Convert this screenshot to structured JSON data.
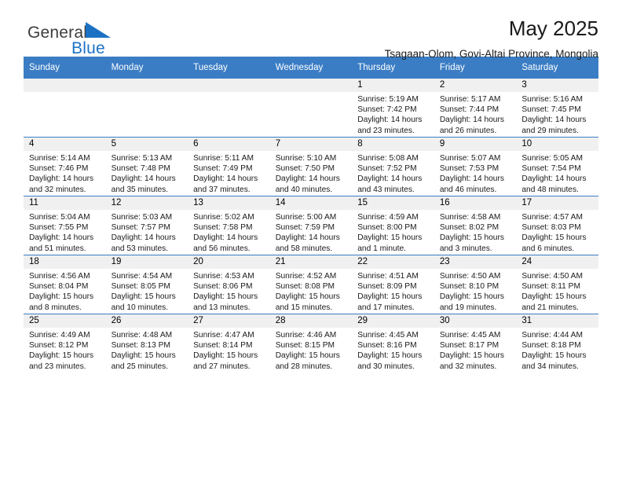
{
  "brand": {
    "name_part1": "General",
    "name_part2": "Blue",
    "triangle_color": "#1b72c4"
  },
  "header": {
    "title": "May 2025",
    "subtitle": "Tsagaan-Olom, Govi-Altai Province, Mongolia"
  },
  "theme": {
    "header_blue": "#3b7dc4",
    "date_band": "#f0f0f0",
    "text": "#1a1a1a"
  },
  "weekday_headers": [
    "Sunday",
    "Monday",
    "Tuesday",
    "Wednesday",
    "Thursday",
    "Friday",
    "Saturday"
  ],
  "weeks": [
    [
      {
        "day": "",
        "empty": true,
        "sunrise": "",
        "sunset": "",
        "daylight1": "",
        "daylight2": ""
      },
      {
        "day": "",
        "empty": true,
        "sunrise": "",
        "sunset": "",
        "daylight1": "",
        "daylight2": ""
      },
      {
        "day": "",
        "empty": true,
        "sunrise": "",
        "sunset": "",
        "daylight1": "",
        "daylight2": ""
      },
      {
        "day": "",
        "empty": true,
        "sunrise": "",
        "sunset": "",
        "daylight1": "",
        "daylight2": ""
      },
      {
        "day": "1",
        "sunrise": "Sunrise: 5:19 AM",
        "sunset": "Sunset: 7:42 PM",
        "daylight1": "Daylight: 14 hours",
        "daylight2": "and 23 minutes."
      },
      {
        "day": "2",
        "sunrise": "Sunrise: 5:17 AM",
        "sunset": "Sunset: 7:44 PM",
        "daylight1": "Daylight: 14 hours",
        "daylight2": "and 26 minutes."
      },
      {
        "day": "3",
        "sunrise": "Sunrise: 5:16 AM",
        "sunset": "Sunset: 7:45 PM",
        "daylight1": "Daylight: 14 hours",
        "daylight2": "and 29 minutes."
      }
    ],
    [
      {
        "day": "4",
        "sunrise": "Sunrise: 5:14 AM",
        "sunset": "Sunset: 7:46 PM",
        "daylight1": "Daylight: 14 hours",
        "daylight2": "and 32 minutes."
      },
      {
        "day": "5",
        "sunrise": "Sunrise: 5:13 AM",
        "sunset": "Sunset: 7:48 PM",
        "daylight1": "Daylight: 14 hours",
        "daylight2": "and 35 minutes."
      },
      {
        "day": "6",
        "sunrise": "Sunrise: 5:11 AM",
        "sunset": "Sunset: 7:49 PM",
        "daylight1": "Daylight: 14 hours",
        "daylight2": "and 37 minutes."
      },
      {
        "day": "7",
        "sunrise": "Sunrise: 5:10 AM",
        "sunset": "Sunset: 7:50 PM",
        "daylight1": "Daylight: 14 hours",
        "daylight2": "and 40 minutes."
      },
      {
        "day": "8",
        "sunrise": "Sunrise: 5:08 AM",
        "sunset": "Sunset: 7:52 PM",
        "daylight1": "Daylight: 14 hours",
        "daylight2": "and 43 minutes."
      },
      {
        "day": "9",
        "sunrise": "Sunrise: 5:07 AM",
        "sunset": "Sunset: 7:53 PM",
        "daylight1": "Daylight: 14 hours",
        "daylight2": "and 46 minutes."
      },
      {
        "day": "10",
        "sunrise": "Sunrise: 5:05 AM",
        "sunset": "Sunset: 7:54 PM",
        "daylight1": "Daylight: 14 hours",
        "daylight2": "and 48 minutes."
      }
    ],
    [
      {
        "day": "11",
        "sunrise": "Sunrise: 5:04 AM",
        "sunset": "Sunset: 7:55 PM",
        "daylight1": "Daylight: 14 hours",
        "daylight2": "and 51 minutes."
      },
      {
        "day": "12",
        "sunrise": "Sunrise: 5:03 AM",
        "sunset": "Sunset: 7:57 PM",
        "daylight1": "Daylight: 14 hours",
        "daylight2": "and 53 minutes."
      },
      {
        "day": "13",
        "sunrise": "Sunrise: 5:02 AM",
        "sunset": "Sunset: 7:58 PM",
        "daylight1": "Daylight: 14 hours",
        "daylight2": "and 56 minutes."
      },
      {
        "day": "14",
        "sunrise": "Sunrise: 5:00 AM",
        "sunset": "Sunset: 7:59 PM",
        "daylight1": "Daylight: 14 hours",
        "daylight2": "and 58 minutes."
      },
      {
        "day": "15",
        "sunrise": "Sunrise: 4:59 AM",
        "sunset": "Sunset: 8:00 PM",
        "daylight1": "Daylight: 15 hours",
        "daylight2": "and 1 minute."
      },
      {
        "day": "16",
        "sunrise": "Sunrise: 4:58 AM",
        "sunset": "Sunset: 8:02 PM",
        "daylight1": "Daylight: 15 hours",
        "daylight2": "and 3 minutes."
      },
      {
        "day": "17",
        "sunrise": "Sunrise: 4:57 AM",
        "sunset": "Sunset: 8:03 PM",
        "daylight1": "Daylight: 15 hours",
        "daylight2": "and 6 minutes."
      }
    ],
    [
      {
        "day": "18",
        "sunrise": "Sunrise: 4:56 AM",
        "sunset": "Sunset: 8:04 PM",
        "daylight1": "Daylight: 15 hours",
        "daylight2": "and 8 minutes."
      },
      {
        "day": "19",
        "sunrise": "Sunrise: 4:54 AM",
        "sunset": "Sunset: 8:05 PM",
        "daylight1": "Daylight: 15 hours",
        "daylight2": "and 10 minutes."
      },
      {
        "day": "20",
        "sunrise": "Sunrise: 4:53 AM",
        "sunset": "Sunset: 8:06 PM",
        "daylight1": "Daylight: 15 hours",
        "daylight2": "and 13 minutes."
      },
      {
        "day": "21",
        "sunrise": "Sunrise: 4:52 AM",
        "sunset": "Sunset: 8:08 PM",
        "daylight1": "Daylight: 15 hours",
        "daylight2": "and 15 minutes."
      },
      {
        "day": "22",
        "sunrise": "Sunrise: 4:51 AM",
        "sunset": "Sunset: 8:09 PM",
        "daylight1": "Daylight: 15 hours",
        "daylight2": "and 17 minutes."
      },
      {
        "day": "23",
        "sunrise": "Sunrise: 4:50 AM",
        "sunset": "Sunset: 8:10 PM",
        "daylight1": "Daylight: 15 hours",
        "daylight2": "and 19 minutes."
      },
      {
        "day": "24",
        "sunrise": "Sunrise: 4:50 AM",
        "sunset": "Sunset: 8:11 PM",
        "daylight1": "Daylight: 15 hours",
        "daylight2": "and 21 minutes."
      }
    ],
    [
      {
        "day": "25",
        "sunrise": "Sunrise: 4:49 AM",
        "sunset": "Sunset: 8:12 PM",
        "daylight1": "Daylight: 15 hours",
        "daylight2": "and 23 minutes."
      },
      {
        "day": "26",
        "sunrise": "Sunrise: 4:48 AM",
        "sunset": "Sunset: 8:13 PM",
        "daylight1": "Daylight: 15 hours",
        "daylight2": "and 25 minutes."
      },
      {
        "day": "27",
        "sunrise": "Sunrise: 4:47 AM",
        "sunset": "Sunset: 8:14 PM",
        "daylight1": "Daylight: 15 hours",
        "daylight2": "and 27 minutes."
      },
      {
        "day": "28",
        "sunrise": "Sunrise: 4:46 AM",
        "sunset": "Sunset: 8:15 PM",
        "daylight1": "Daylight: 15 hours",
        "daylight2": "and 28 minutes."
      },
      {
        "day": "29",
        "sunrise": "Sunrise: 4:45 AM",
        "sunset": "Sunset: 8:16 PM",
        "daylight1": "Daylight: 15 hours",
        "daylight2": "and 30 minutes."
      },
      {
        "day": "30",
        "sunrise": "Sunrise: 4:45 AM",
        "sunset": "Sunset: 8:17 PM",
        "daylight1": "Daylight: 15 hours",
        "daylight2": "and 32 minutes."
      },
      {
        "day": "31",
        "sunrise": "Sunrise: 4:44 AM",
        "sunset": "Sunset: 8:18 PM",
        "daylight1": "Daylight: 15 hours",
        "daylight2": "and 34 minutes."
      }
    ]
  ]
}
